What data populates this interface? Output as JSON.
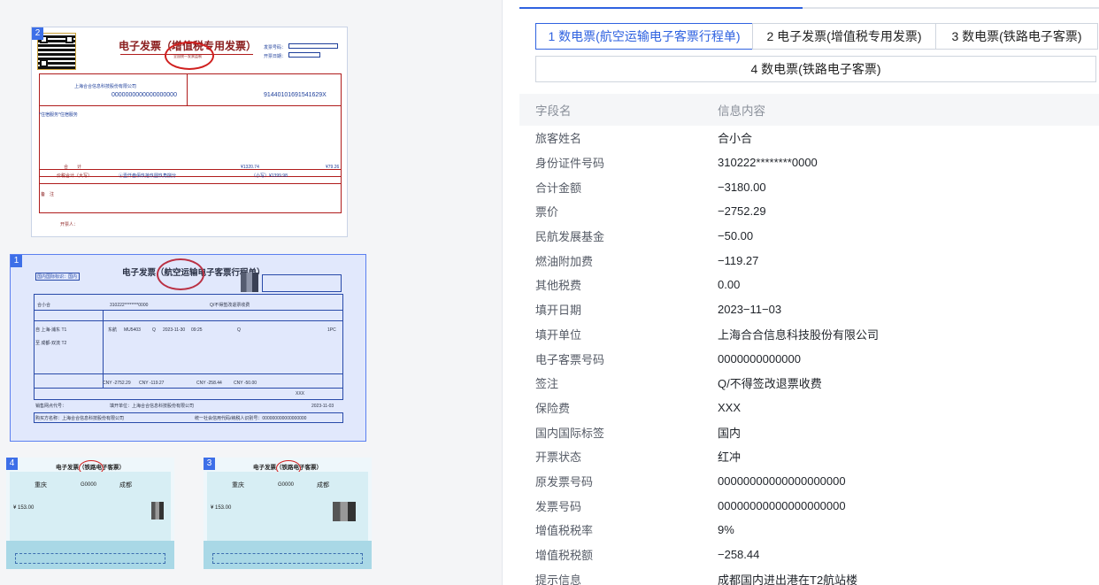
{
  "thumbnails": [
    {
      "index": "2",
      "title": "电子发票（增值税专用发票）",
      "seal_text": "全国统一发票监制",
      "buyer_name": "上海合合信息科技股份有限公司",
      "buyer_tax_id": "0000000000000000000",
      "seller_tax_id": "91440101691541629X",
      "item_name": "*住宿服务*住宿服务",
      "total_label": "合　　计",
      "total_amount": "¥1320.74",
      "total_tax": "¥79.26",
      "tax_total_label": "价税合计（大写）",
      "amount_words": "ⓧ壹仟叁佰玖拾玖圆玖角捌分",
      "amount_small": "（小写）¥1399.98",
      "remarks_label": "备　注",
      "drawer_label": "开票人：",
      "number_label": "发票号码：",
      "date_label": "开票日期："
    },
    {
      "index": "1",
      "title": "电子发票（航空运输电子客票行程单）",
      "region_label": "国内国际标识：国内",
      "passenger": "合小合",
      "id_number": "310222********0000",
      "endorse": "Q/不得签改退票收费",
      "route_from": "自 上海-浦东 T1",
      "route_to": "至 成都-双流 T2",
      "carrier": "东航",
      "flight": "MU5403",
      "seat_class": "Q",
      "flight_date": "2023-11-30",
      "flight_time": "09:25",
      "fare_basis": "Q",
      "baggage": "1PC",
      "fare": "CNY -2752.29",
      "fuel": "CNY -119.27",
      "vat": "CNY -258.44",
      "fund": "CNY -50.00",
      "insurance": "XXX",
      "unit_label": "填开单位：上海合合信息科技股份有限公司",
      "fill_date": "2023-11-03",
      "buyer_label": "购买方名称：上海合合信息科技股份有限公司",
      "buyer_tax_label": "统一社会信用代码/纳税人识别号：000000000000000000",
      "agent_label": "销售网点代号："
    },
    {
      "index": "4",
      "title": "电子发票（铁路电子客票）",
      "from_station": "重庆",
      "to_station": "成都",
      "train_no": "G0000",
      "price": "¥ 153.00"
    },
    {
      "index": "3",
      "title": "电子发票（铁路电子客票）",
      "from_station": "重庆",
      "to_station": "成都",
      "train_no": "G0000",
      "price": "¥ 153.00"
    }
  ],
  "tabs": [
    {
      "label": "1 数电票(航空运输电子客票行程单)",
      "active": true
    },
    {
      "label": "2 电子发票(增值税专用发票)",
      "active": false
    },
    {
      "label": "3 数电票(铁路电子客票)",
      "active": false
    },
    {
      "label": "4 数电票(铁路电子客票)",
      "active": false
    }
  ],
  "table": {
    "header_key": "字段名",
    "header_value": "信息内容",
    "rows": [
      {
        "key": "旅客姓名",
        "value": "合小合"
      },
      {
        "key": "身份证件号码",
        "value": "310222********0000"
      },
      {
        "key": "合计金额",
        "value": "−3180.00"
      },
      {
        "key": "票价",
        "value": "−2752.29"
      },
      {
        "key": "民航发展基金",
        "value": "−50.00"
      },
      {
        "key": "燃油附加费",
        "value": "−119.27"
      },
      {
        "key": "其他税费",
        "value": "0.00"
      },
      {
        "key": "填开日期",
        "value": "2023−11−03"
      },
      {
        "key": "填开单位",
        "value": "上海合合信息科技股份有限公司"
      },
      {
        "key": "电子客票号码",
        "value": "0000000000000"
      },
      {
        "key": "签注",
        "value": "Q/不得签改退票收费"
      },
      {
        "key": "保险费",
        "value": "XXX"
      },
      {
        "key": "国内国际标签",
        "value": "国内"
      },
      {
        "key": "开票状态",
        "value": "红冲"
      },
      {
        "key": "原发票号码",
        "value": "00000000000000000000"
      },
      {
        "key": "发票号码",
        "value": "00000000000000000000"
      },
      {
        "key": "增值税税率",
        "value": "9%"
      },
      {
        "key": "增值税税额",
        "value": "−258.44"
      },
      {
        "key": "提示信息",
        "value": "成都国内进出港在T2航站楼"
      }
    ]
  },
  "colors": {
    "accent": "#2f62e0",
    "seal_red": "#d0201f",
    "invoice_blue": "#1e3f9a"
  }
}
